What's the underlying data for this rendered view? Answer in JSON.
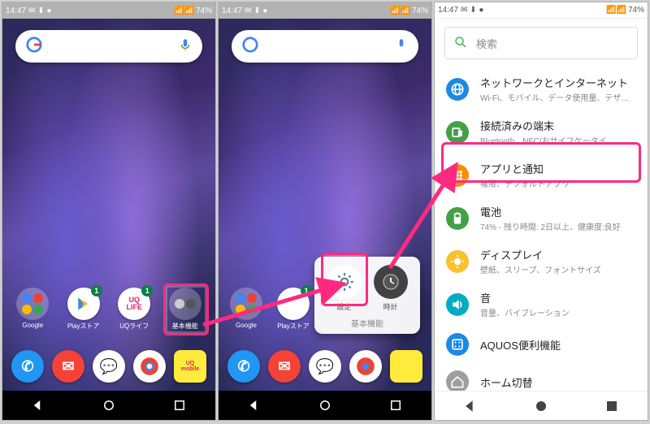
{
  "status": {
    "time": "14:47",
    "battery": "74%"
  },
  "search_placeholder_settings": "検索",
  "home": {
    "apps": [
      {
        "label": "Google",
        "badge": null
      },
      {
        "label": "Playストア",
        "badge": "1"
      },
      {
        "label": "UQライフ",
        "badge": "1"
      }
    ],
    "folder_label": "基本機能",
    "dock": [
      "電話",
      "ドコモメール",
      "メッセージ",
      "Chrome",
      "UQ mobile"
    ]
  },
  "folder_popup": {
    "title": "基本機能",
    "items": [
      {
        "label": "設定"
      },
      {
        "label": "時計"
      }
    ]
  },
  "settings": [
    {
      "title": "ネットワークとインターネット",
      "sub": "Wi-Fi、モバイル、データ使用量、テザリ…",
      "color": "#1e88e5",
      "icon": "globe"
    },
    {
      "title": "接続済みの端末",
      "sub": "Bluetooth、NFC/おサイフケータイ",
      "color": "#43a047",
      "icon": "devices"
    },
    {
      "title": "アプリと通知",
      "sub": "権限、デフォルトアプリ",
      "color": "#fb8c00",
      "icon": "apps",
      "highlight": true
    },
    {
      "title": "電池",
      "sub": "74% - 残り時間: 2日以上、健康度:良好",
      "color": "#43a047",
      "icon": "battery"
    },
    {
      "title": "ディスプレイ",
      "sub": "壁紙、スリープ、フォントサイズ",
      "color": "#fbc02d",
      "icon": "display"
    },
    {
      "title": "音",
      "sub": "音量、バイブレーション",
      "color": "#00acc1",
      "icon": "sound"
    },
    {
      "title": "AQUOS便利機能",
      "sub": "",
      "color": "#1e88e5",
      "icon": "aquos"
    },
    {
      "title": "ホーム切替",
      "sub": "",
      "color": "#9e9e9e",
      "icon": "home"
    }
  ]
}
